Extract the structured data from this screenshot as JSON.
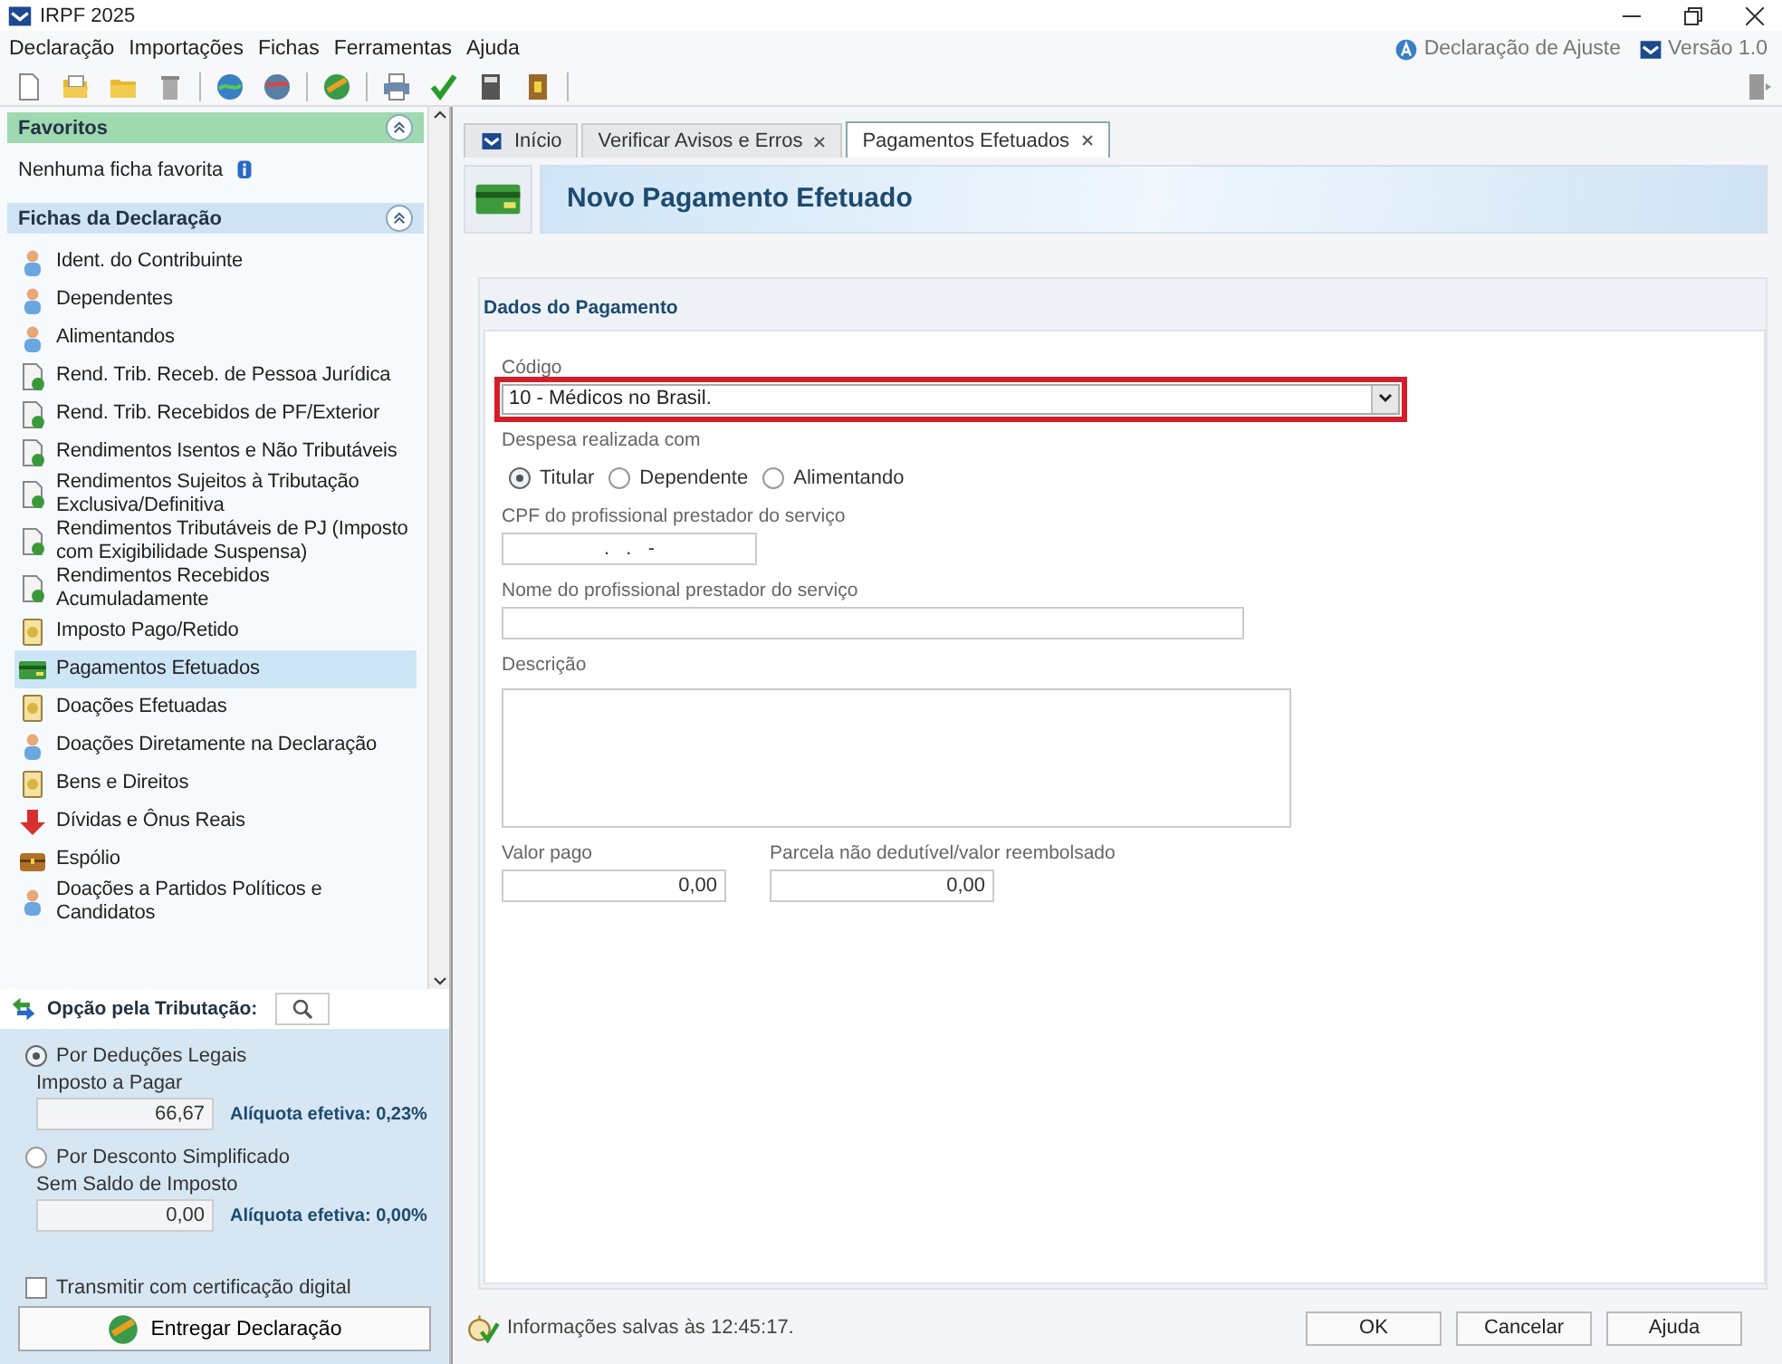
{
  "window": {
    "title": "IRPF 2025"
  },
  "menu": [
    "Declaração",
    "Importações",
    "Fichas",
    "Ferramentas",
    "Ajuda"
  ],
  "header_right": {
    "mode": "Declaração de Ajuste",
    "version": "Versão 1.0"
  },
  "favorites": {
    "title": "Favoritos",
    "empty_text": "Nenhuma ficha favorita"
  },
  "fichas": {
    "title": "Fichas da Declaração",
    "items": [
      {
        "label": "Ident. do Contribuinte",
        "selected": false
      },
      {
        "label": "Dependentes",
        "selected": false
      },
      {
        "label": "Alimentandos",
        "selected": false
      },
      {
        "label": "Rend. Trib. Receb. de Pessoa Jurídica",
        "selected": false
      },
      {
        "label": "Rend. Trib. Recebidos de PF/Exterior",
        "selected": false
      },
      {
        "label": "Rendimentos Isentos e Não Tributáveis",
        "selected": false
      },
      {
        "label": "Rendimentos Sujeitos à Tributação Exclusiva/Definitiva",
        "selected": false
      },
      {
        "label": "Rendimentos Tributáveis de PJ (Imposto com Exigibilidade Suspensa)",
        "selected": false
      },
      {
        "label": "Rendimentos Recebidos Acumuladamente",
        "selected": false
      },
      {
        "label": "Imposto Pago/Retido",
        "selected": false
      },
      {
        "label": "Pagamentos Efetuados",
        "selected": true
      },
      {
        "label": "Doações Efetuadas",
        "selected": false
      },
      {
        "label": "Doações Diretamente na Declaração",
        "selected": false
      },
      {
        "label": "Bens e Direitos",
        "selected": false
      },
      {
        "label": "Dívidas e Ônus Reais",
        "selected": false
      },
      {
        "label": "Espólio",
        "selected": false
      },
      {
        "label": "Doações a Partidos Políticos e Candidatos",
        "selected": false
      }
    ]
  },
  "tributacao": {
    "title": "Opção pela Tributação:",
    "options": [
      {
        "label": "Por Deduções Legais",
        "selected": true,
        "result_label": "Imposto a Pagar",
        "value": "66,67",
        "rate": "Alíquota efetiva: 0,23%"
      },
      {
        "label": "Por Desconto Simplificado",
        "selected": false,
        "result_label": "Sem Saldo de Imposto",
        "value": "0,00",
        "rate": "Alíquota efetiva: 0,00%"
      }
    ]
  },
  "transmit": {
    "label": "Transmitir com certificação digital",
    "checked": false
  },
  "deliver_button": "Entregar Declaração",
  "tabs": [
    {
      "label": "Início",
      "selected": false,
      "closable": false
    },
    {
      "label": "Verificar Avisos e Erros",
      "selected": false,
      "closable": true
    },
    {
      "label": "Pagamentos Efetuados",
      "selected": true,
      "closable": true
    }
  ],
  "page_title": "Novo Pagamento Efetuado",
  "form": {
    "section": "Dados do Pagamento",
    "codigo": {
      "label": "Código",
      "value": "10 - Médicos no Brasil.",
      "highlighted": true
    },
    "despesa": {
      "label": "Despesa realizada com",
      "options": [
        {
          "label": "Titular",
          "selected": true
        },
        {
          "label": "Dependente",
          "selected": false
        },
        {
          "label": "Alimentando",
          "selected": false
        }
      ]
    },
    "cpf": {
      "label": "CPF do profissional prestador do serviço",
      "value": ".   .   -"
    },
    "nome": {
      "label": "Nome do profissional prestador do serviço"
    },
    "descricao": {
      "label": "Descrição"
    },
    "valor_pago": {
      "label": "Valor pago",
      "value": "0,00"
    },
    "parcela": {
      "label": "Parcela não dedutível/valor reembolsado",
      "value": "0,00"
    }
  },
  "status": {
    "message": "Informações salvas às 12:45:17."
  },
  "buttons": [
    "OK",
    "Cancelar",
    "Ajuda"
  ]
}
